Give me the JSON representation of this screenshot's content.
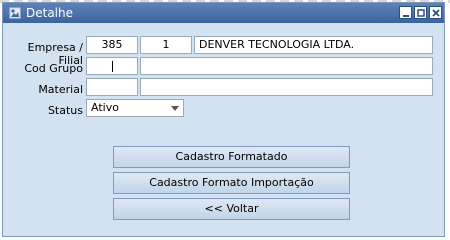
{
  "window": {
    "title": "Detalhe",
    "icon": "app-icon",
    "controls": [
      "minimize-icon",
      "maximize-icon",
      "close-icon"
    ]
  },
  "form": {
    "empresa_filial": {
      "label": "Empresa / Filial",
      "empresa": "385",
      "filial": "1",
      "nome": "DENVER TECNOLOGIA LTDA."
    },
    "cod_grupo": {
      "label": "Cod Grupo",
      "value": "",
      "description": ""
    },
    "material": {
      "label": "Material",
      "value": "",
      "description": ""
    },
    "status": {
      "label": "Status",
      "selected": "Ativo"
    }
  },
  "buttons": {
    "cadastro_formatado": "Cadastro Formatado",
    "cadastro_formato_importacao": "Cadastro Formato Importação",
    "voltar": "<< Voltar"
  },
  "colors": {
    "titlebar": "#3b64a0",
    "panel": "#d2e2f1",
    "button": "#c2d5ea"
  }
}
